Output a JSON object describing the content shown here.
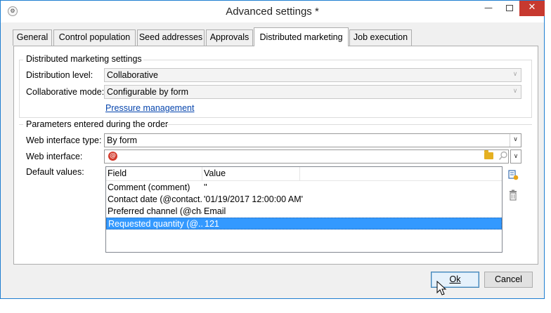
{
  "window": {
    "title": "Advanced settings *",
    "app_icon": "app-icon",
    "controls": {
      "minimize": "minimize-icon",
      "maximize": "maximize-icon",
      "close": "close-icon"
    }
  },
  "tabs": [
    {
      "label": "General",
      "active": false
    },
    {
      "label": "Control population",
      "active": false
    },
    {
      "label": "Seed addresses",
      "active": false
    },
    {
      "label": "Approvals",
      "active": false
    },
    {
      "label": "Distributed marketing",
      "active": true
    },
    {
      "label": "Job execution",
      "active": false
    }
  ],
  "distributed": {
    "section_title": "Distributed marketing settings",
    "distribution_level": {
      "label": "Distribution level:",
      "value": "Collaborative"
    },
    "collaborative_mode": {
      "label": "Collaborative mode:",
      "value": "Configurable by form"
    },
    "pressure_link": "Pressure management"
  },
  "parameters": {
    "section_title": "Parameters entered during the order",
    "web_interface_type": {
      "label": "Web interface type:",
      "value": "By form"
    },
    "web_interface": {
      "label": "Web interface:",
      "value": ""
    },
    "default_values": {
      "label": "Default values:",
      "columns": [
        "Field",
        "Value"
      ],
      "rows": [
        {
          "field": "Comment (comment)",
          "value": "''",
          "selected": false
        },
        {
          "field": "Contact date (@contact...",
          "value": "'01/19/2017 12:00:00 AM'",
          "selected": false
        },
        {
          "field": "Preferred channel (@cha...",
          "value": "Email",
          "selected": false
        },
        {
          "field": "Requested quantity (@...",
          "value": "121",
          "selected": true
        }
      ]
    }
  },
  "buttons": {
    "ok": "Ok",
    "cancel": "Cancel"
  },
  "colors": {
    "selection": "#3399ff",
    "link": "#0645ad",
    "close_button": "#c7392f",
    "at_icon": "#d33a2c",
    "folder": "#e5b021"
  }
}
